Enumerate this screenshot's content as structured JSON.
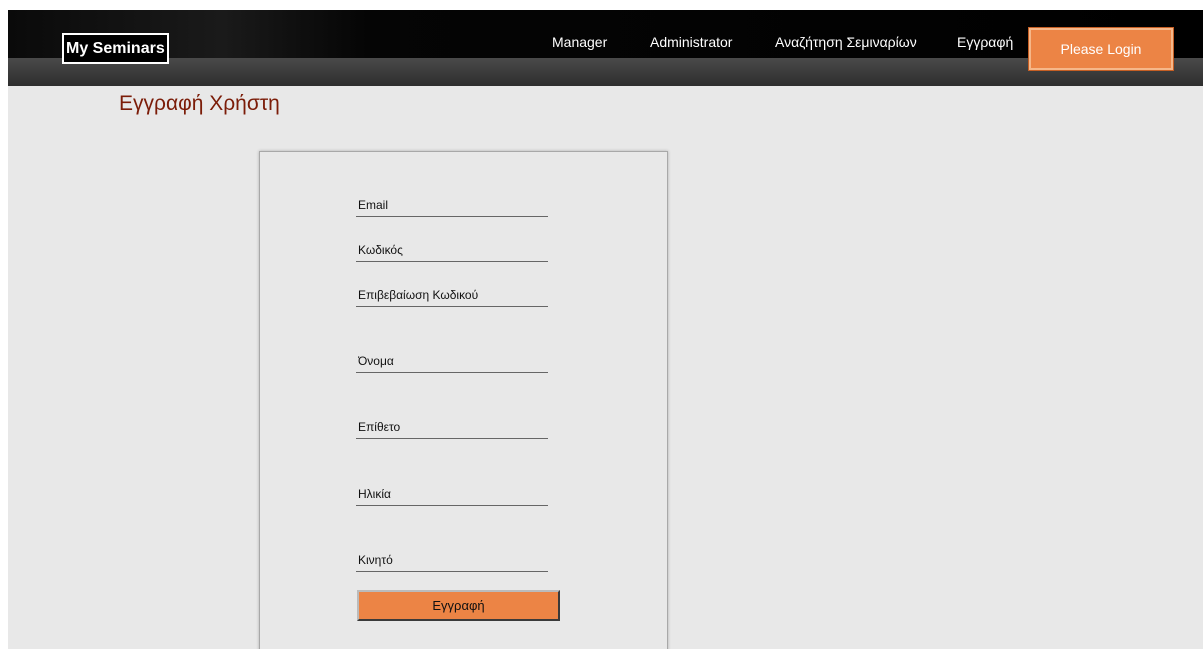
{
  "navbar": {
    "brand": "My Seminars",
    "links": [
      "Manager",
      "Administrator",
      "Αναζήτηση Σεμιναρίων",
      "Εγγραφή"
    ],
    "login_label": "Please Login"
  },
  "page": {
    "title": "Εγγραφή Χρήστη"
  },
  "form": {
    "fields": [
      {
        "placeholder": "Email",
        "value": ""
      },
      {
        "placeholder": "Κωδικός",
        "value": ""
      },
      {
        "placeholder": "Επιβεβαίωση Κωδικού",
        "value": ""
      },
      {
        "placeholder": "Όνομα",
        "value": ""
      },
      {
        "placeholder": "Επίθετο",
        "value": ""
      },
      {
        "placeholder": "Ηλικία",
        "value": ""
      },
      {
        "placeholder": "Κινητό",
        "value": ""
      }
    ],
    "submit_label": "Εγγραφή"
  },
  "colors": {
    "accent": "#ec8445",
    "title": "#7b1c08",
    "navbar": "#000000",
    "background": "#e8e8e8"
  }
}
